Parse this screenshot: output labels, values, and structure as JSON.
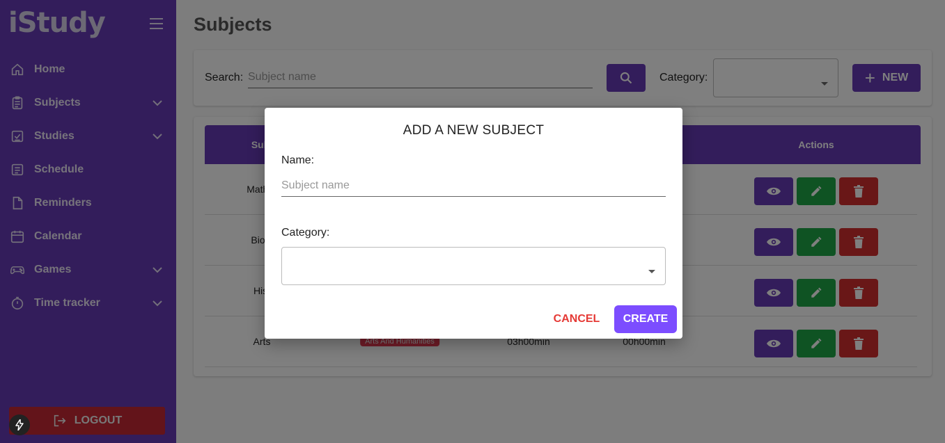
{
  "app": {
    "logo": "iStudy"
  },
  "sidebar": {
    "items": [
      {
        "label": "Home",
        "icon": "home-icon",
        "expandable": false
      },
      {
        "label": "Subjects",
        "icon": "clipboard-icon",
        "expandable": true
      },
      {
        "label": "Studies",
        "icon": "checklist-icon",
        "expandable": true
      },
      {
        "label": "Schedule",
        "icon": "schedule-icon",
        "expandable": false
      },
      {
        "label": "Reminders",
        "icon": "document-icon",
        "expandable": false
      },
      {
        "label": "Calendar",
        "icon": "calendar-icon",
        "expandable": false
      },
      {
        "label": "Games",
        "icon": "gamepad-icon",
        "expandable": true
      },
      {
        "label": "Time tracker",
        "icon": "timer-icon",
        "expandable": true
      }
    ],
    "logout_label": "LOGOUT"
  },
  "page": {
    "title": "Subjects"
  },
  "search": {
    "label": "Search:",
    "placeholder": "Subject name",
    "value": "",
    "category_label": "Category:",
    "category_value": "",
    "new_label": "NEW"
  },
  "table": {
    "headers": [
      "Subj",
      "Actions"
    ],
    "rows": [
      {
        "subject": "Mather",
        "category": "",
        "c3": "",
        "c4": ""
      },
      {
        "subject": "Biolo",
        "category": "",
        "c3": "",
        "c4": ""
      },
      {
        "subject": "Hist",
        "category": "",
        "c3": "",
        "c4": ""
      },
      {
        "subject": "Arts",
        "category": "Arts And Humanities",
        "c3": "03h00min",
        "c4": "00h00min"
      }
    ]
  },
  "dialog": {
    "title": "ADD A NEW SUBJECT",
    "name_label": "Name:",
    "name_placeholder": "Subject name",
    "name_value": "",
    "category_label": "Category:",
    "category_value": "",
    "cancel_label": "CANCEL",
    "create_label": "CREATE"
  },
  "colors": {
    "primary": "#673ab7",
    "success": "#1ea646",
    "danger": "#d32f2f",
    "create": "#7c4dff",
    "cancel_text": "#e53935",
    "badge": "#e53950"
  }
}
